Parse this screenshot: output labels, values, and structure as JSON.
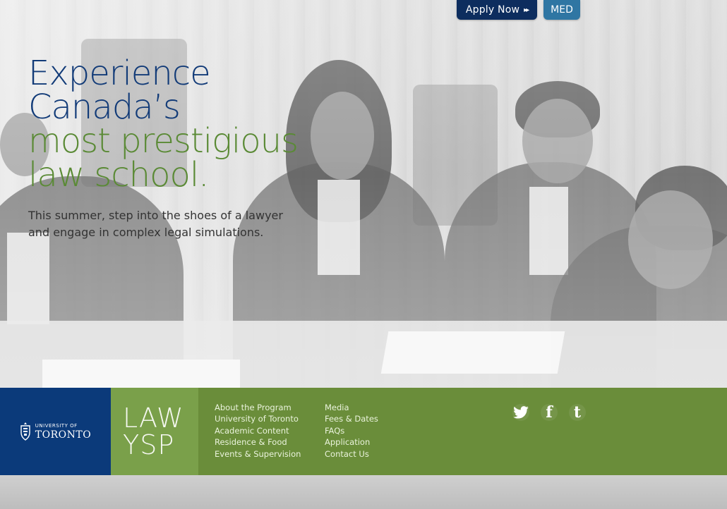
{
  "header": {
    "apply_label": "Apply Now",
    "apply_chevrons": "▸▸",
    "med_label": "MED"
  },
  "hero": {
    "headline_line1": "Experience",
    "headline_line2": "Canada’s",
    "headline_line3": "most prestigious",
    "headline_line4": "law school.",
    "subtext": "This summer, step into the shoes of a lawyer and engage in complex legal simulations."
  },
  "footer": {
    "uoft_small": "UNIVERSITY OF",
    "uoft_big": "TORONTO",
    "program_line1": "LAW",
    "program_line2": "YSP",
    "nav_col1": [
      {
        "label": "About the Program"
      },
      {
        "label": "University of Toronto"
      },
      {
        "label": "Academic Content"
      },
      {
        "label": "Residence & Food"
      },
      {
        "label": "Events & Supervision"
      }
    ],
    "nav_col2": [
      {
        "label": "Media"
      },
      {
        "label": "Fees & Dates"
      },
      {
        "label": "FAQs"
      },
      {
        "label": "Application"
      },
      {
        "label": "Contact Us"
      }
    ],
    "social": [
      "twitter-icon",
      "facebook-icon",
      "tumblr-icon"
    ]
  },
  "colors": {
    "navy": "#0d2d5e",
    "med_blue": "#2f76a3",
    "headline_blue": "#123b78",
    "headline_green": "#5a8a35",
    "footer_green": "#6a8d3a",
    "uoft_blue": "#0b3a7a"
  }
}
